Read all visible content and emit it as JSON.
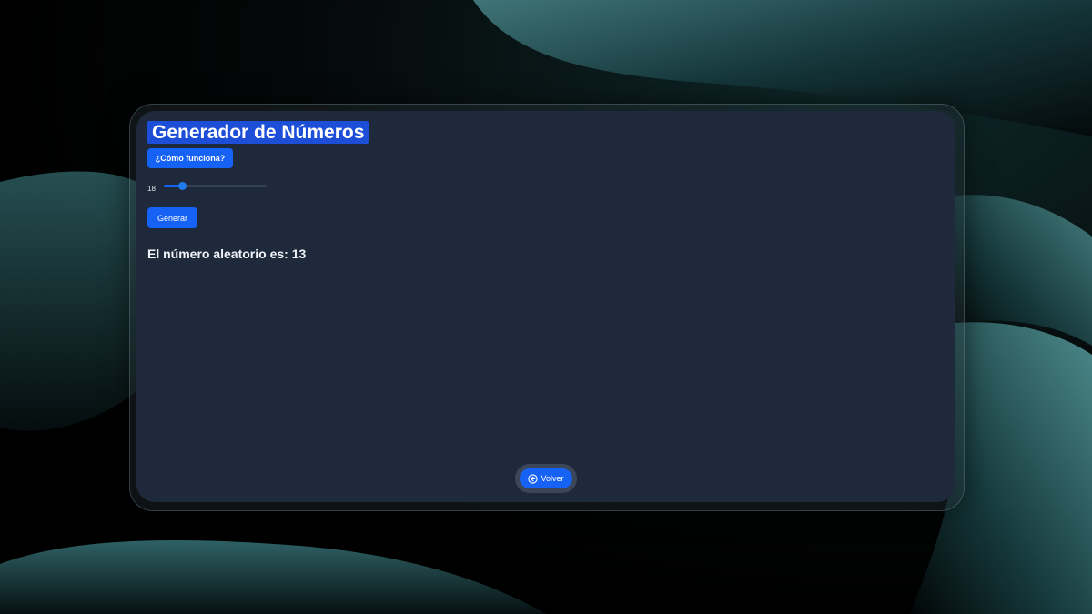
{
  "app": {
    "title": "Generador de Números"
  },
  "controls": {
    "how_label": "¿Cómo funciona?",
    "slider": {
      "value_label": "18",
      "level": 0.18
    },
    "generate_label": "Generar"
  },
  "result": {
    "text": "El número aleatorio es: 13"
  },
  "footer": {
    "back_label": "Volver",
    "back_icon": "arrow-left-circle-icon"
  },
  "colors": {
    "accent": "#1662f5",
    "title_highlight": "#1d4ed8",
    "panel": "#1e293b"
  }
}
